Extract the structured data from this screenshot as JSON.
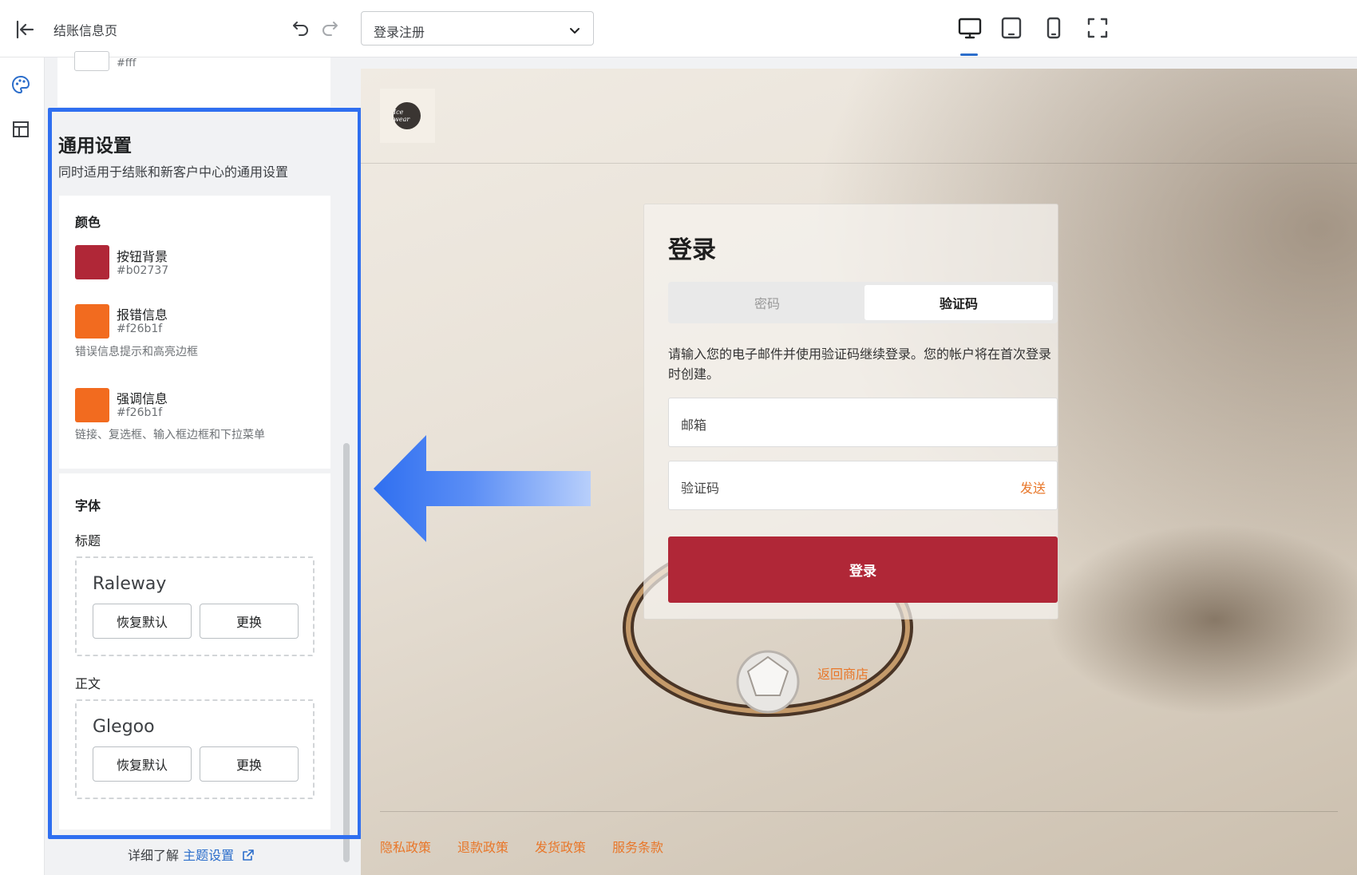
{
  "topbar": {
    "page_name": "结账信息页",
    "page_select_value": "登录注册"
  },
  "devices": [
    "desktop-icon",
    "tablet-icon",
    "mobile-icon",
    "fullscreen-icon"
  ],
  "panel": {
    "prev_swatch_hex": "#fff",
    "section_title": "通用设置",
    "section_subtitle": "同时适用于结账和新客户中心的通用设置",
    "colors": {
      "label": "颜色",
      "items": [
        {
          "name": "按钮背景",
          "hex": "#b02737",
          "color": "#b02737",
          "help": ""
        },
        {
          "name": "报错信息",
          "hex": "#f26b1f",
          "color": "#f26b1f",
          "help": "错误信息提示和高亮边框"
        },
        {
          "name": "强调信息",
          "hex": "#f26b1f",
          "color": "#f26b1f",
          "help": "链接、复选框、输入框边框和下拉菜单"
        }
      ]
    },
    "fonts": {
      "label": "字体",
      "heading_label": "标题",
      "heading_font": "Raleway",
      "body_label": "正文",
      "body_font": "Glegoo",
      "reset_label": "恢复默认",
      "change_label": "更换"
    },
    "learn_more_prefix": "详细了解",
    "learn_more_link": "主题设置"
  },
  "preview": {
    "logo_text": "Ice wear",
    "login_title": "登录",
    "tab_password": "密码",
    "tab_code": "验证码",
    "description": "请输入您的电子邮件并使用验证码继续登录。您的帐户将在首次登录时创建。",
    "email_placeholder": "邮箱",
    "code_placeholder": "验证码",
    "send_label": "发送",
    "login_button": "登录",
    "back_to_shop": "返回商店",
    "footer_links": [
      "隐私政策",
      "退款政策",
      "发货政策",
      "服务条款"
    ],
    "accent_color": "#e8772a",
    "button_color": "#b02737"
  },
  "highlight_color": "#2f6ff0"
}
